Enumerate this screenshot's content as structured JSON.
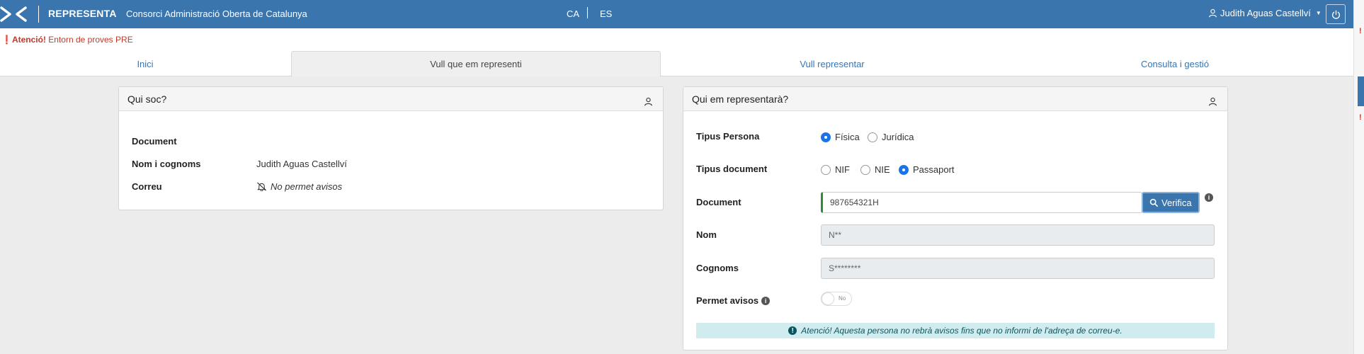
{
  "header": {
    "app_name": "REPRESENTA",
    "organization": "Consorci Administració Oberta de Catalunya",
    "lang_ca": "CA",
    "lang_es": "ES",
    "user_name": "Judith Aguas Castellví",
    "brand_color": "#3a75ad"
  },
  "alert": {
    "prefix": "Atenció!",
    "message": "Entorn de proves PRE"
  },
  "tabs": [
    {
      "label": "Inici"
    },
    {
      "label": "Vull que em representi"
    },
    {
      "label": "Vull representar"
    },
    {
      "label": "Consulta i gestió"
    }
  ],
  "who_am_i": {
    "title": "Qui soc?",
    "document_label": "Document",
    "document_value": "",
    "name_label": "Nom i cognoms",
    "name_value": "Judith  Aguas Castellví",
    "email_label": "Correu",
    "email_value": "No permet avisos"
  },
  "representative": {
    "title": "Qui em representarà?",
    "person_type_label": "Tipus Persona",
    "person_type_options": [
      "Física",
      "Jurídica"
    ],
    "person_type_selected": "Física",
    "doc_type_label": "Tipus document",
    "doc_type_options": [
      "NIF",
      "NIE",
      "Passaport"
    ],
    "doc_type_selected": "Passaport",
    "document_label": "Document",
    "document_value": "987654321H",
    "verify_button": "Verifica",
    "name_label": "Nom",
    "name_value": "N**",
    "surname_label": "Cognoms",
    "surname_value": "S********",
    "notices_label": "Permet avisos",
    "notices_toggle": "No",
    "warning": "Atenció! Aquesta persona no rebrà avisos fins que no informi de l'adreça de correu-e."
  }
}
